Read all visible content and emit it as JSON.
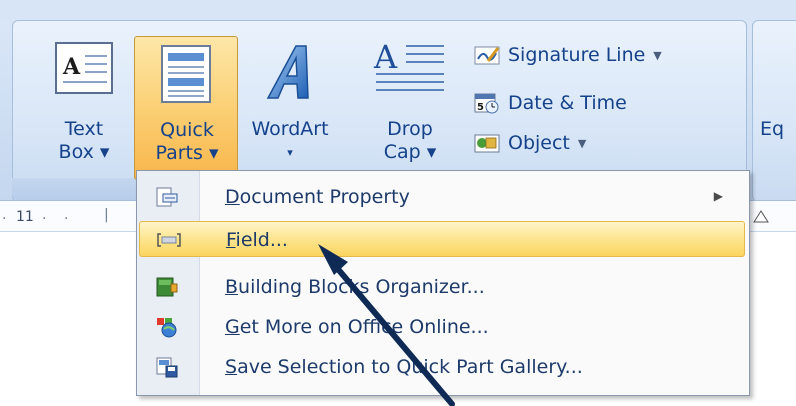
{
  "ribbon": {
    "text_box": {
      "line1": "Text",
      "line2": "Box ▾"
    },
    "quick_parts": {
      "line1": "Quick",
      "line2": "Parts ▾"
    },
    "wordart": {
      "line1": "WordArt",
      "line2": "▾"
    },
    "drop_cap": {
      "line1": "Drop",
      "line2": "Cap ▾"
    },
    "signature_line": "Signature Line",
    "date_time": "Date & Time",
    "object": "Object",
    "next_group_fragment": "Eq"
  },
  "ruler": {
    "tick_label": "11"
  },
  "menu": {
    "items": [
      {
        "mnemonic": "D",
        "rest": "ocument Property",
        "has_submenu": true
      },
      {
        "mnemonic": "F",
        "rest": "ield...",
        "highlighted": true
      },
      {
        "mnemonic": "B",
        "rest": "uilding Blocks Organizer..."
      },
      {
        "mnemonic": "G",
        "rest": "et More on Office Online..."
      },
      {
        "mnemonic": "S",
        "rest": "ave Selection to Quick Part Gallery..."
      }
    ]
  },
  "colors": {
    "ribbon_text": "#15428b",
    "highlight": "#fbd27a",
    "menu_text": "#1d3a6b",
    "annotation_arrow": "#0f2b55"
  }
}
